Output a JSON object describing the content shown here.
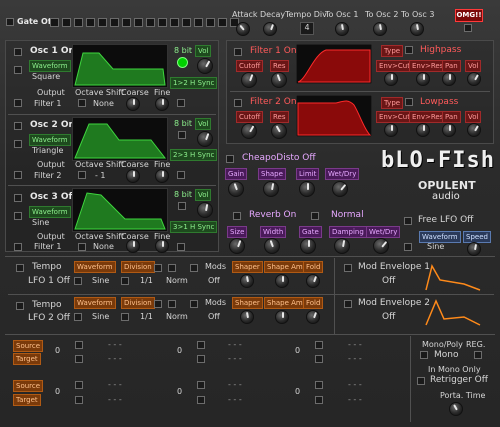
{
  "top": {
    "gate": "Gate Off",
    "attack": "Attack",
    "decay": "Decay",
    "tempo_div": "Tempo Div",
    "tempo_div_val": "4",
    "to_osc1": "To Osc 1",
    "to_osc2": "To Osc 2",
    "to_osc3": "To Osc 3",
    "omg": "OMG!!"
  },
  "osc1": {
    "title": "Osc 1 On",
    "wave_lbl": "Waveform",
    "wave": "Square",
    "bit": "8 bit",
    "vol": "Vol",
    "sync": "1>2 H Sync",
    "out_lbl": "Output",
    "out": "Filter 1",
    "shift_lbl": "Octave Shift",
    "shift": "None",
    "coarse": "Coarse",
    "fine": "Fine"
  },
  "osc2": {
    "title": "Osc 2 On",
    "wave_lbl": "Waveform",
    "wave": "Triangle",
    "bit": "8 bit",
    "vol": "Vol",
    "sync": "2>3 H Sync",
    "out_lbl": "Output",
    "out": "Filter 2",
    "shift_lbl": "Octave Shift",
    "shift": "- 1",
    "coarse": "Coarse",
    "fine": "Fine"
  },
  "osc3": {
    "title": "Osc 3 Off",
    "wave_lbl": "Waveform",
    "wave": "Sine",
    "bit": "8 bit",
    "vol": "Vol",
    "sync": "3>1 H Sync",
    "out_lbl": "Output",
    "out": "Filter 1",
    "shift_lbl": "Octave Shift",
    "shift": "None",
    "coarse": "Coarse",
    "fine": "Fine"
  },
  "filter1": {
    "title": "Filter 1 On",
    "type_lbl": "Type",
    "type": "Highpass",
    "cutoff": "Cutoff",
    "res": "Res",
    "envcut": "Env>Cut",
    "envres": "Env>Res",
    "pan": "Pan",
    "vol": "Vol"
  },
  "filter2": {
    "title": "Filter 2 On",
    "type_lbl": "Type",
    "type": "Lowpass",
    "cutoff": "Cutoff",
    "res": "Res",
    "envcut": "Env>Cut",
    "envres": "Env>Res",
    "pan": "Pan",
    "vol": "Vol"
  },
  "disto": {
    "title": "CheapoDisto Off",
    "gain": "Gain",
    "shape": "Shape",
    "limit": "Limit",
    "wetdry": "Wet/Dry"
  },
  "reverb": {
    "title": "Reverb On",
    "mode": "Normal",
    "size": "Size",
    "width": "Width",
    "gate": "Gate",
    "damping": "Damping",
    "wetdry": "Wet/Dry"
  },
  "logo": {
    "title": "bLO-FIsh",
    "brand1": "OPULENT",
    "brand2": "audio"
  },
  "freelfo": {
    "title": "Free LFO Off",
    "wave_lbl": "Waveform",
    "wave": "Sine",
    "speed": "Speed"
  },
  "lfo1": {
    "tempo": "Tempo",
    "name": "LFO 1 Off",
    "wave_lbl": "Waveform",
    "wave": "Sine",
    "div_lbl": "Division",
    "div": "1/1",
    "norm": "Norm",
    "mods": "Mods",
    "mods_val": "Off",
    "shaper": "Shaper",
    "shape_amt": "Shape Amt",
    "fold": "Fold"
  },
  "lfo2": {
    "tempo": "Tempo",
    "name": "LFO 2 Off",
    "wave_lbl": "Waveform",
    "wave": "Sine",
    "div_lbl": "Division",
    "div": "1/1",
    "norm": "Norm",
    "mods": "Mods",
    "mods_val": "Off",
    "shaper": "Shaper",
    "shape_amt": "Shape Amt",
    "fold": "Fold"
  },
  "modenv1": {
    "title": "Mod Envelope 1",
    "val": "Off"
  },
  "modenv2": {
    "title": "Mod Envelope 2",
    "val": "Off"
  },
  "matrix": {
    "source": "Source",
    "target": "Target",
    "zero": "0",
    "dash": "- - -"
  },
  "right": {
    "mono_poly": "Mono/Poly",
    "reg": "REG.",
    "mono": "Mono",
    "in_mono": "In Mono Only",
    "retrigger": "Retrigger Off",
    "porta": "Porta. Time"
  }
}
